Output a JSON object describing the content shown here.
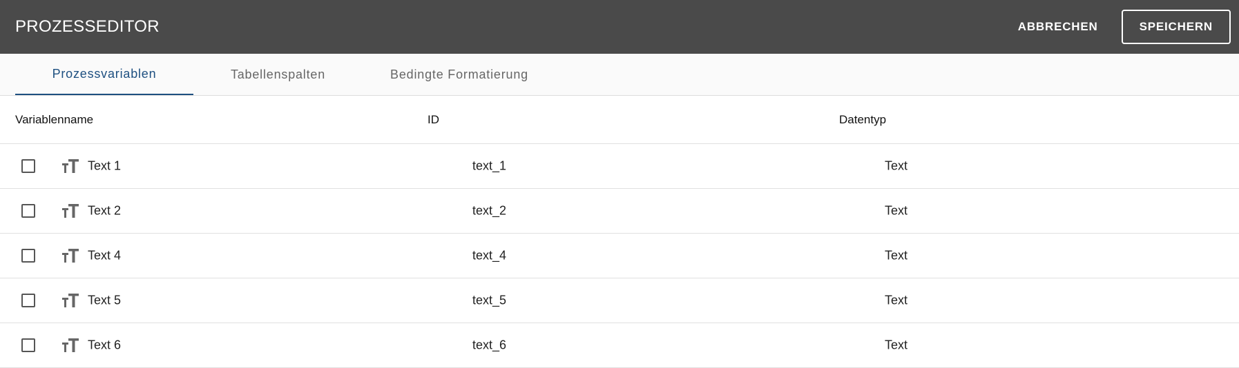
{
  "appbar": {
    "title": "PROZESSEDITOR",
    "cancel_label": "ABBRECHEN",
    "save_label": "SPEICHERN",
    "background": "#4a4a4a"
  },
  "tabs": [
    {
      "label": "Prozessvariablen",
      "active": true
    },
    {
      "label": "Tabellenspalten",
      "active": false
    },
    {
      "label": "Bedingte Formatierung",
      "active": false
    }
  ],
  "accent_color": "#1d4f80",
  "table": {
    "headers": {
      "name": "Variablenname",
      "id": "ID",
      "type": "Datentyp"
    },
    "rows": [
      {
        "checked": false,
        "icon": "text-fields-icon",
        "name": "Text 1",
        "id": "text_1",
        "type": "Text"
      },
      {
        "checked": false,
        "icon": "text-fields-icon",
        "name": "Text 2",
        "id": "text_2",
        "type": "Text"
      },
      {
        "checked": false,
        "icon": "text-fields-icon",
        "name": "Text 4",
        "id": "text_4",
        "type": "Text"
      },
      {
        "checked": false,
        "icon": "text-fields-icon",
        "name": "Text 5",
        "id": "text_5",
        "type": "Text"
      },
      {
        "checked": false,
        "icon": "text-fields-icon",
        "name": "Text 6",
        "id": "text_6",
        "type": "Text"
      }
    ]
  }
}
